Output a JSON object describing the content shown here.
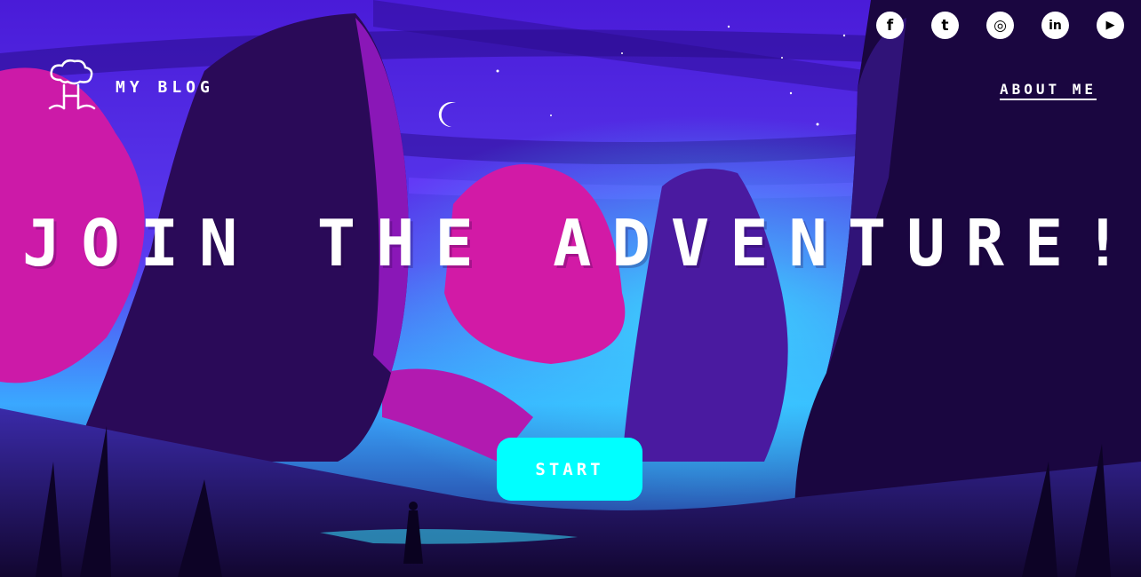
{
  "header": {
    "brand": "MY BLOG",
    "nav_about": "ABOUT ME"
  },
  "social": [
    {
      "name": "facebook-icon",
      "glyph": "f"
    },
    {
      "name": "tumblr-icon",
      "glyph": "t"
    },
    {
      "name": "instagram-icon",
      "glyph": "◎"
    },
    {
      "name": "linkedin-icon",
      "glyph": "in"
    },
    {
      "name": "youtube-icon",
      "glyph": "▶"
    }
  ],
  "hero": {
    "title": "JOIN THE ADVENTURE!",
    "cta": "START"
  },
  "colors": {
    "accent": "#00ffff",
    "sky_top": "#5a22e8",
    "sky_glow": "#2ec8ff",
    "magenta": "#cc1aa8",
    "rock": "#2a0a58"
  }
}
